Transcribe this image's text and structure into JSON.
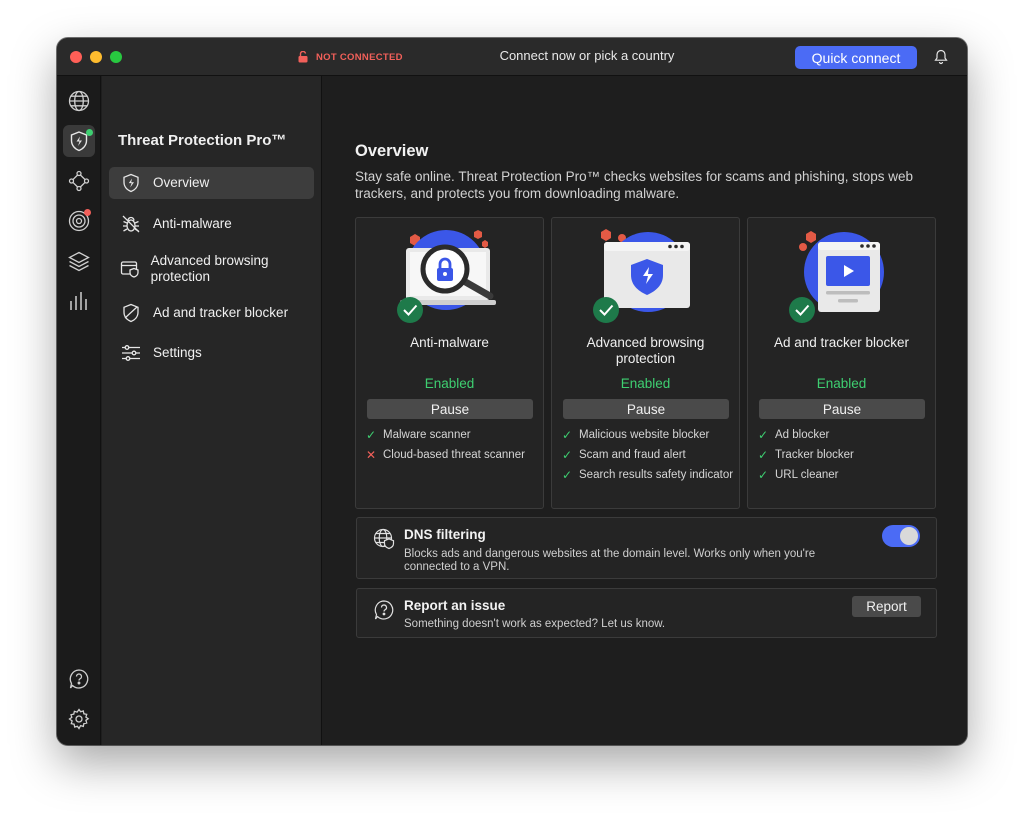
{
  "titlebar": {
    "status": "NOT CONNECTED",
    "connect_prompt": "Connect now or pick a country",
    "quick_connect": "Quick connect"
  },
  "rail": {
    "icons": [
      "globe-icon",
      "threat-protection-icon",
      "meshnet-icon",
      "target-icon",
      "layers-icon",
      "stats-icon",
      "help-icon",
      "settings-icon"
    ]
  },
  "sidebar": {
    "title": "Threat Protection Pro™",
    "items": [
      {
        "label": "Overview",
        "icon": "shield-icon",
        "active": true
      },
      {
        "label": "Anti-malware",
        "icon": "bug-icon",
        "active": false
      },
      {
        "label": "Advanced browsing protection",
        "icon": "browser-shield-icon",
        "active": false
      },
      {
        "label": "Ad and tracker blocker",
        "icon": "ad-block-icon",
        "active": false
      },
      {
        "label": "Settings",
        "icon": "sliders-icon",
        "active": false
      }
    ]
  },
  "main": {
    "title": "Overview",
    "description": "Stay safe online. Threat Protection Pro™ checks websites for scams and phishing, stops web trackers, and protects you from downloading malware.",
    "cards": [
      {
        "title": "Anti-malware",
        "status": "Enabled",
        "button": "Pause",
        "features": [
          {
            "label": "Malware scanner",
            "ok": true
          },
          {
            "label": "Cloud-based threat scanner",
            "ok": false
          }
        ]
      },
      {
        "title": "Advanced browsing protection",
        "status": "Enabled",
        "button": "Pause",
        "features": [
          {
            "label": "Malicious website blocker",
            "ok": true
          },
          {
            "label": "Scam and fraud alert",
            "ok": true
          },
          {
            "label": "Search results safety indicator",
            "ok": true
          }
        ]
      },
      {
        "title": "Ad and tracker blocker",
        "status": "Enabled",
        "button": "Pause",
        "features": [
          {
            "label": "Ad blocker",
            "ok": true
          },
          {
            "label": "Tracker blocker",
            "ok": true
          },
          {
            "label": "URL cleaner",
            "ok": true
          }
        ]
      }
    ],
    "dns": {
      "title": "DNS filtering",
      "description": "Blocks ads and dangerous websites at the domain level. Works only when you're connected to a VPN.",
      "enabled": true
    },
    "report": {
      "title": "Report an issue",
      "description": "Something doesn't work as expected? Let us know.",
      "button": "Report"
    }
  },
  "colors": {
    "accent": "#4b6bf5",
    "enabled": "#3ecf71",
    "danger": "#f2605a",
    "check_badge": "#1e7a4a"
  }
}
